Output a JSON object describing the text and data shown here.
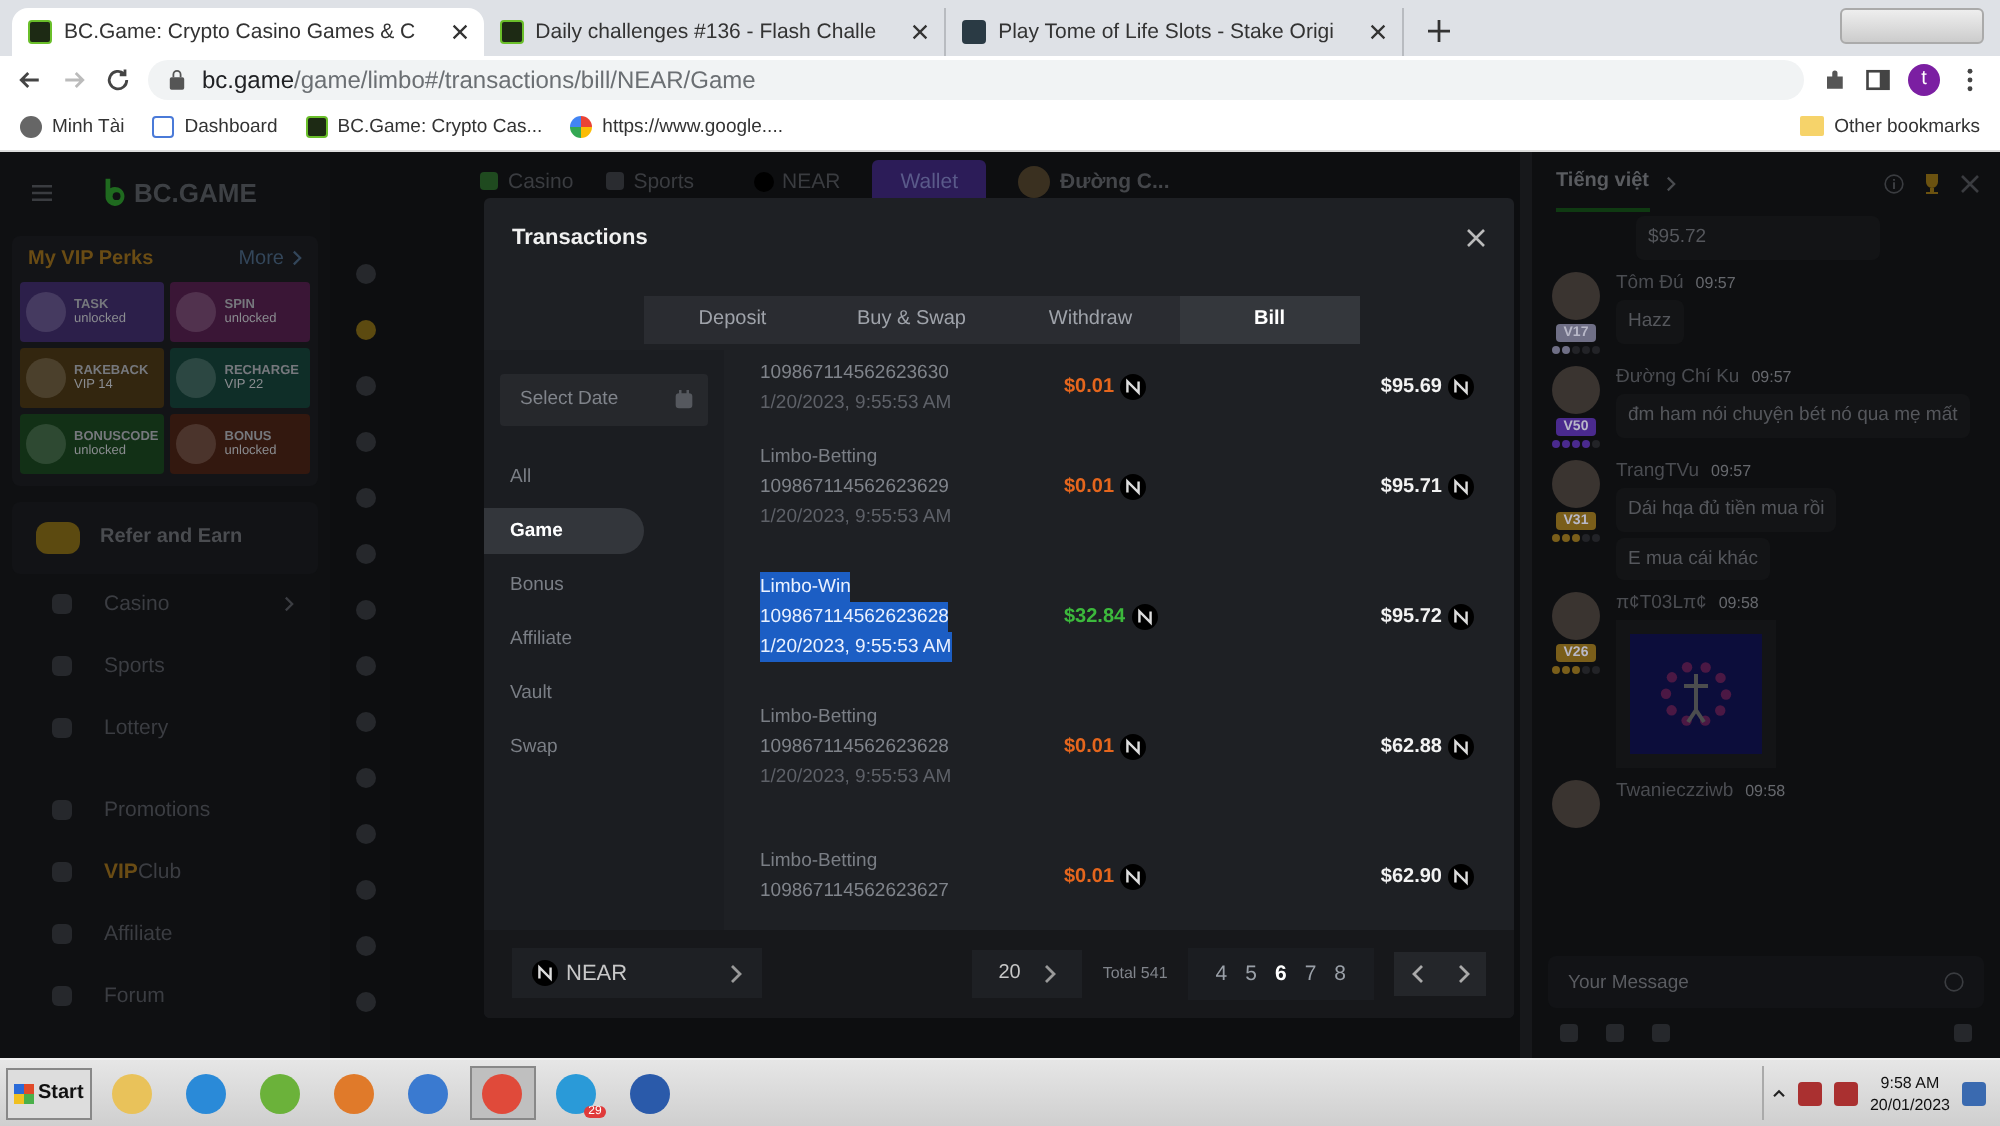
{
  "browser": {
    "tabs": [
      {
        "title": "BC.Game: Crypto Casino Games & C",
        "selected": true
      },
      {
        "title": "Daily challenges #136 - Flash Challe",
        "selected": false
      },
      {
        "title": "Play Tome of Life Slots - Stake Origi",
        "selected": false
      }
    ],
    "address": {
      "host": "bc.game",
      "path": "/game/limbo#/transactions/bill/NEAR/Game"
    },
    "profile": "t",
    "bookmarks": [
      "Minh Tài",
      "Dashboard",
      "BC.Game: Crypto Cas...",
      "https://www.google...."
    ],
    "other_bookmarks": "Other bookmarks"
  },
  "site": {
    "logo": "BC.GAME",
    "header": {
      "casino": "Casino",
      "sports": "Sports",
      "currency": "NEAR",
      "wallet": "Wallet",
      "user": "Đường C..."
    },
    "vip_perks": {
      "title": "My VIP Perks",
      "more": "More",
      "perks": [
        {
          "name": "TASK",
          "status": "unlocked",
          "color": "#2c1f4a"
        },
        {
          "name": "SPIN",
          "status": "unlocked",
          "color": "#3a1636"
        },
        {
          "name": "RAKEBACK",
          "status": "VIP 14",
          "color": "#33260f"
        },
        {
          "name": "RECHARGE",
          "status": "VIP 22",
          "color": "#0f2e28"
        },
        {
          "name": "BONUSCODE",
          "status": "unlocked",
          "color": "#123016"
        },
        {
          "name": "BONUS",
          "status": "unlocked",
          "color": "#33180f"
        }
      ]
    },
    "refer": "Refer and Earn",
    "nav": [
      {
        "label": "Casino",
        "arrow": true
      },
      {
        "label": "Sports",
        "arrow": false
      },
      {
        "label": "Lottery",
        "arrow": false
      },
      {
        "label": "Promotions",
        "arrow": false
      },
      {
        "accent": "VIP",
        "label": "Club",
        "arrow": false
      },
      {
        "label": "Affiliate",
        "arrow": false
      },
      {
        "label": "Forum",
        "arrow": false
      }
    ]
  },
  "chat": {
    "language": "Tiếng việt",
    "top_bubble": "$95.72",
    "users": [
      {
        "name": "Tôm Đú",
        "time": "09:57",
        "vip": "V17",
        "color": "#6f6f86",
        "stars": 2,
        "messages": [
          "Hazz"
        ],
        "sticker": false
      },
      {
        "name": "Đường Chí Ku",
        "time": "09:57",
        "vip": "V50",
        "color": "#4a2a8e",
        "stars": 4,
        "messages": [
          "đm ham nói chuyện bét nó qua mẹ mất"
        ],
        "sticker": false
      },
      {
        "name": "TrangTVu",
        "time": "09:57",
        "vip": "V31",
        "color": "#7a5e1a",
        "stars": 3,
        "messages": [
          "Dái hqa đủ tiền mua rồi",
          "E mua cái khác"
        ],
        "sticker": false
      },
      {
        "name": "π¢T03Lπ¢",
        "time": "09:58",
        "vip": "V26",
        "color": "#7a5e1a",
        "stars": 3,
        "sticker": true
      },
      {
        "name": "Twanieczziwb",
        "time": "09:58",
        "sticker": false
      }
    ],
    "input": {
      "placeholder": "Your Message"
    }
  },
  "modal": {
    "title": "Transactions",
    "tabs": [
      {
        "label": "Deposit",
        "selected": false
      },
      {
        "label": "Buy & Swap",
        "selected": false
      },
      {
        "label": "Withdraw",
        "selected": false
      },
      {
        "label": "Bill",
        "selected": true
      }
    ],
    "date_field": {
      "placeholder": "Select Date"
    },
    "categories": [
      {
        "label": "All",
        "selected": false
      },
      {
        "label": "Game",
        "selected": true
      },
      {
        "label": "Bonus",
        "selected": false
      },
      {
        "label": "Affiliate",
        "selected": false
      },
      {
        "label": "Vault",
        "selected": false
      },
      {
        "label": "Swap",
        "selected": false
      }
    ],
    "rows": [
      {
        "id": "109867114562623630",
        "date": "1/20/2023, 9:55:53 AM",
        "amount": "$0.01",
        "kind": "debit",
        "balance": "$95.69",
        "text_selected": false
      },
      {
        "type": "Limbo-Betting",
        "id": "109867114562623629",
        "date": "1/20/2023, 9:55:53 AM",
        "amount": "$0.01",
        "kind": "debit",
        "balance": "$95.71",
        "text_selected": false
      },
      {
        "type": "Limbo-Win",
        "id": "109867114562623628",
        "date": "1/20/2023, 9:55:53 AM",
        "amount": "$32.84",
        "kind": "credit",
        "balance": "$95.72",
        "text_selected": true
      },
      {
        "type": "Limbo-Betting",
        "id": "109867114562623628",
        "date": "1/20/2023, 9:55:53 AM",
        "amount": "$0.01",
        "kind": "debit",
        "balance": "$62.88",
        "text_selected": false
      },
      {
        "type": "Limbo-Betting",
        "id": "109867114562623627",
        "amount": "$0.01",
        "kind": "debit",
        "balance": "$62.90",
        "text_selected": false
      }
    ],
    "footer": {
      "currency": "NEAR",
      "page_size": "20",
      "total": "Total 541",
      "pages": [
        {
          "label": "4",
          "selected": false
        },
        {
          "label": "5",
          "selected": false
        },
        {
          "label": "6",
          "selected": true
        },
        {
          "label": "7",
          "selected": false
        },
        {
          "label": "8",
          "selected": false
        }
      ]
    }
  },
  "taskbar": {
    "start": "Start",
    "apps": [
      {
        "kind": "folder",
        "selected": false
      },
      {
        "kind": "ie",
        "selected": false
      },
      {
        "kind": "coccoc",
        "selected": false
      },
      {
        "kind": "media",
        "selected": false
      },
      {
        "kind": "weibo",
        "selected": false
      },
      {
        "kind": "chrome",
        "selected": true
      },
      {
        "kind": "telegram",
        "badge": "29",
        "selected": false
      },
      {
        "kind": "word",
        "selected": false
      }
    ],
    "time": "9:58 AM",
    "date": "20/01/2023"
  }
}
